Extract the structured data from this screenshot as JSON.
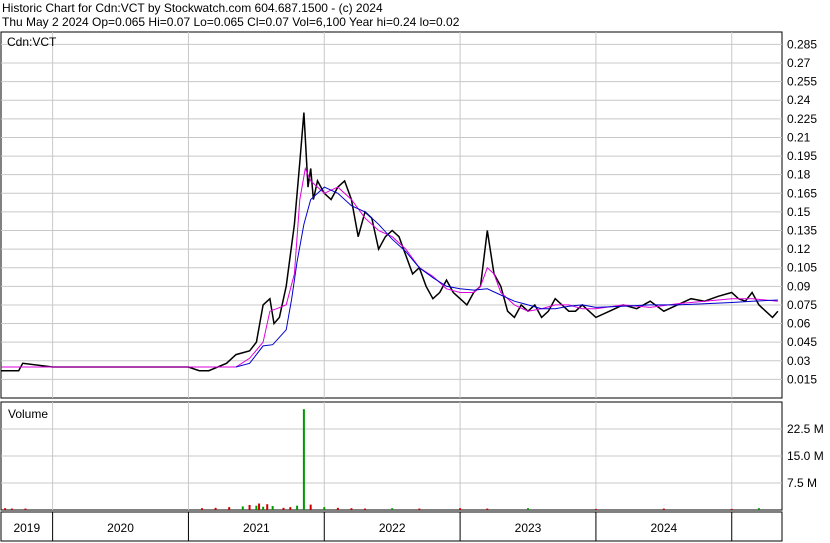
{
  "header": {
    "line1": "Historic Chart for Cdn:VCT by Stockwatch.com 604.687.1500 - (c) 2024",
    "line2": "Thu May  2 2024  Op=0.065  Hi=0.07  Lo=0.065  Cl=0.07  Vol=6,100  Year hi=0.24  lo=0.02"
  },
  "colors": {
    "price": "#000000",
    "ma_short": "#dd00dd",
    "ma_long": "#0000cc",
    "grid": "#c8c8c8",
    "volume_up": "#009900",
    "volume_down": "#cc0000"
  },
  "chart_data": [
    {
      "type": "line",
      "legend_label": "Cdn:VCT",
      "ylim": [
        0.0,
        0.295
      ],
      "y_ticks": [
        "0.285",
        "0.27",
        "0.255",
        "0.24",
        "0.225",
        "0.21",
        "0.195",
        "0.18",
        "0.165",
        "0.15",
        "0.135",
        "0.12",
        "0.105",
        "0.09",
        "0.075",
        "0.06",
        "0.045",
        "0.03",
        "0.015"
      ],
      "x_labels": [
        "2019",
        "2020",
        "2021",
        "2022",
        "2023",
        "2024"
      ],
      "year_boundaries": [
        2019.0,
        2020.0,
        2021.0,
        2022.0,
        2023.0,
        2024.0
      ],
      "xlim": [
        2018.62,
        2024.37
      ],
      "series": [
        {
          "key": "price",
          "x": [
            2018.62,
            2018.75,
            2018.78,
            2019.0,
            2019.5,
            2020.0,
            2020.08,
            2020.15,
            2020.28,
            2020.35,
            2020.45,
            2020.5,
            2020.55,
            2020.6,
            2020.63,
            2020.67,
            2020.72,
            2020.78,
            2020.82,
            2020.85,
            2020.88,
            2020.9,
            2020.92,
            2020.95,
            2021.0,
            2021.05,
            2021.1,
            2021.15,
            2021.2,
            2021.25,
            2021.3,
            2021.35,
            2021.4,
            2021.45,
            2021.5,
            2021.55,
            2021.6,
            2021.65,
            2021.7,
            2021.75,
            2021.8,
            2021.85,
            2021.9,
            2021.95,
            2022.0,
            2022.05,
            2022.1,
            2022.15,
            2022.2,
            2022.25,
            2022.3,
            2022.35,
            2022.4,
            2022.45,
            2022.5,
            2022.55,
            2022.6,
            2022.65,
            2022.7,
            2022.75,
            2022.8,
            2022.85,
            2022.9,
            2022.95,
            2023.0,
            2023.1,
            2023.2,
            2023.3,
            2023.4,
            2023.5,
            2023.6,
            2023.7,
            2023.8,
            2023.9,
            2024.0,
            2024.05,
            2024.1,
            2024.15,
            2024.2,
            2024.25,
            2024.3,
            2024.34
          ],
          "y": [
            0.022,
            0.022,
            0.028,
            0.025,
            0.025,
            0.025,
            0.022,
            0.022,
            0.028,
            0.035,
            0.038,
            0.045,
            0.075,
            0.08,
            0.06,
            0.065,
            0.09,
            0.14,
            0.19,
            0.23,
            0.17,
            0.185,
            0.16,
            0.175,
            0.165,
            0.16,
            0.17,
            0.175,
            0.16,
            0.13,
            0.15,
            0.145,
            0.12,
            0.13,
            0.135,
            0.13,
            0.115,
            0.1,
            0.105,
            0.09,
            0.08,
            0.085,
            0.095,
            0.085,
            0.08,
            0.075,
            0.085,
            0.09,
            0.135,
            0.1,
            0.09,
            0.07,
            0.065,
            0.075,
            0.07,
            0.075,
            0.065,
            0.07,
            0.08,
            0.075,
            0.07,
            0.07,
            0.075,
            0.07,
            0.065,
            0.07,
            0.075,
            0.072,
            0.078,
            0.07,
            0.075,
            0.08,
            0.078,
            0.082,
            0.085,
            0.08,
            0.078,
            0.085,
            0.075,
            0.07,
            0.065,
            0.07
          ]
        },
        {
          "key": "ma_short",
          "x": [
            2018.62,
            2020.35,
            2020.45,
            2020.55,
            2020.6,
            2020.65,
            2020.72,
            2020.78,
            2020.82,
            2020.86,
            2020.9,
            2021.0,
            2021.1,
            2021.2,
            2021.3,
            2021.4,
            2021.5,
            2021.6,
            2021.7,
            2021.8,
            2021.9,
            2022.0,
            2022.1,
            2022.15,
            2022.2,
            2022.25,
            2022.3,
            2022.4,
            2022.5,
            2022.6,
            2022.7,
            2022.8,
            2022.9,
            2023.0,
            2023.2,
            2023.4,
            2023.6,
            2023.8,
            2024.0,
            2024.15,
            2024.34
          ],
          "y": [
            0.025,
            0.025,
            0.032,
            0.045,
            0.07,
            0.072,
            0.075,
            0.1,
            0.16,
            0.185,
            0.175,
            0.165,
            0.17,
            0.16,
            0.145,
            0.135,
            0.13,
            0.12,
            0.105,
            0.098,
            0.088,
            0.085,
            0.085,
            0.09,
            0.105,
            0.1,
            0.085,
            0.075,
            0.07,
            0.072,
            0.075,
            0.075,
            0.072,
            0.072,
            0.075,
            0.073,
            0.076,
            0.078,
            0.08,
            0.08,
            0.078
          ]
        },
        {
          "key": "ma_long",
          "x": [
            2020.35,
            2020.45,
            2020.5,
            2020.55,
            2020.62,
            2020.72,
            2020.76,
            2020.8,
            2020.85,
            2020.9,
            2021.0,
            2021.1,
            2021.2,
            2021.3,
            2021.4,
            2021.5,
            2021.6,
            2021.7,
            2021.8,
            2021.9,
            2022.0,
            2022.1,
            2022.2,
            2022.3,
            2022.4,
            2022.5,
            2022.6,
            2022.7,
            2022.8,
            2022.9,
            2023.0,
            2023.2,
            2023.4,
            2023.6,
            2023.8,
            2024.0,
            2024.15,
            2024.34
          ],
          "y": [
            0.025,
            0.028,
            0.035,
            0.042,
            0.043,
            0.055,
            0.08,
            0.11,
            0.14,
            0.16,
            0.17,
            0.165,
            0.155,
            0.15,
            0.14,
            0.128,
            0.118,
            0.105,
            0.097,
            0.09,
            0.088,
            0.087,
            0.088,
            0.083,
            0.078,
            0.075,
            0.072,
            0.072,
            0.074,
            0.075,
            0.073,
            0.074,
            0.075,
            0.075,
            0.076,
            0.077,
            0.078,
            0.079
          ]
        }
      ]
    },
    {
      "type": "bar",
      "title": "Volume",
      "y_ticks": [
        "22.5 M",
        "15.0 M",
        "7.5 M"
      ],
      "y_tick_values": [
        22.5,
        15.0,
        7.5
      ],
      "ylim": [
        0,
        30
      ],
      "x": [
        2018.65,
        2018.7,
        2018.8,
        2020.1,
        2020.2,
        2020.3,
        2020.4,
        2020.45,
        2020.5,
        2020.52,
        2020.55,
        2020.58,
        2020.62,
        2020.7,
        2020.75,
        2020.8,
        2020.85,
        2020.9,
        2021.0,
        2021.1,
        2021.2,
        2021.3,
        2021.5,
        2021.7,
        2022.0,
        2022.2,
        2022.5,
        2023.0,
        2023.5,
        2024.0,
        2024.2
      ],
      "values": [
        0.5,
        0.4,
        0.4,
        0.5,
        0.6,
        0.8,
        1.0,
        1.4,
        1.2,
        1.8,
        0.9,
        1.6,
        1.1,
        0.6,
        0.8,
        1.2,
        28.0,
        1.5,
        0.8,
        0.6,
        0.5,
        0.4,
        0.5,
        0.4,
        0.5,
        0.4,
        0.5,
        0.3,
        0.4,
        0.3,
        0.5
      ],
      "up": [
        false,
        false,
        false,
        false,
        false,
        false,
        true,
        false,
        true,
        false,
        true,
        false,
        true,
        false,
        false,
        true,
        true,
        false,
        true,
        false,
        false,
        false,
        true,
        false,
        false,
        false,
        true,
        false,
        false,
        false,
        true
      ]
    }
  ]
}
